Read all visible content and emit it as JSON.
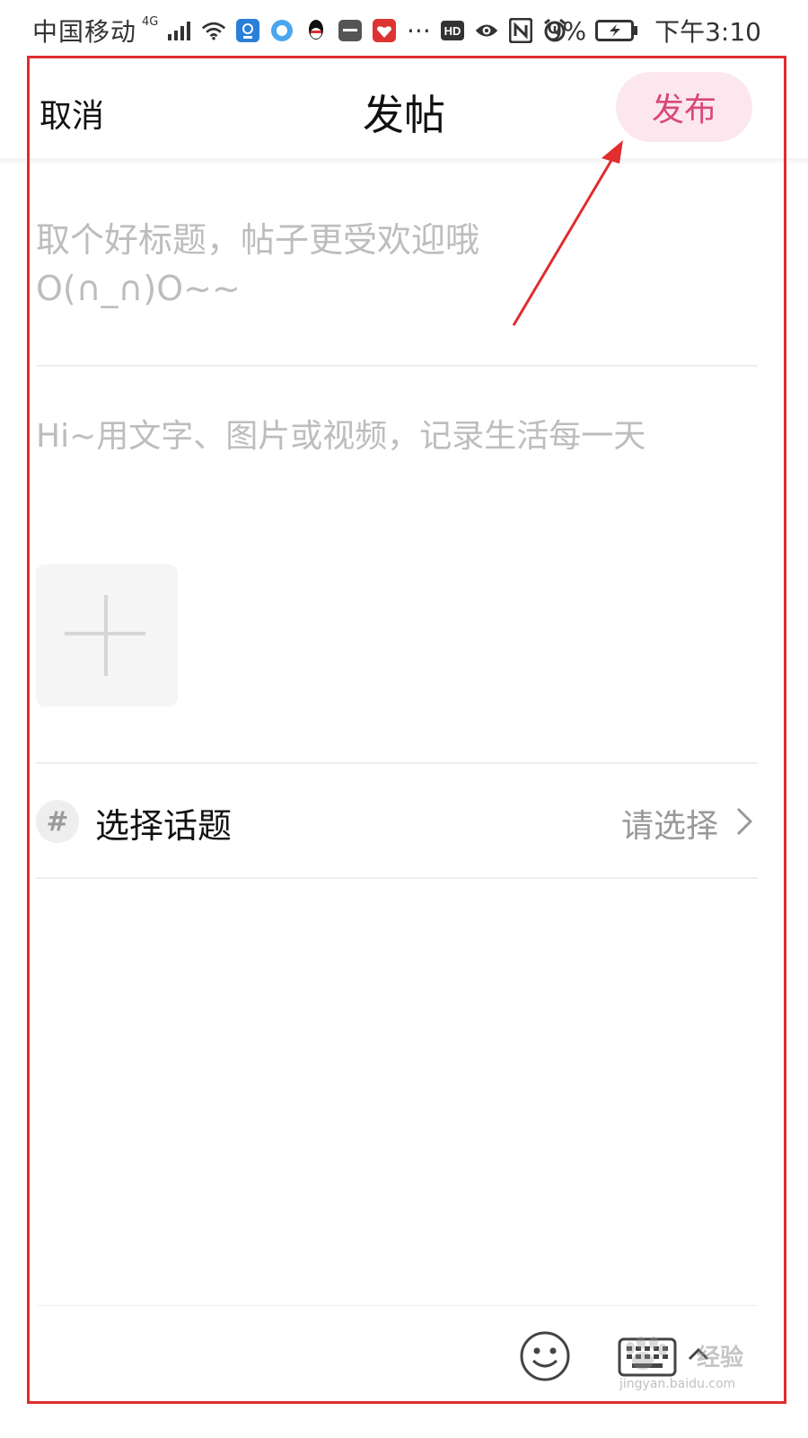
{
  "status_bar": {
    "carrier": "中国移动",
    "network": "4G",
    "battery_percent": "9%",
    "time": "下午3:10",
    "icons": [
      "signal-icon",
      "wifi-icon",
      "app-icon",
      "browser-icon",
      "qq-icon",
      "huawei-icon",
      "gift-icon",
      "more-icon",
      "hd-icon",
      "eye-icon",
      "nfc-icon",
      "alarm-icon",
      "battery-icon"
    ],
    "hd_label": "HD",
    "more_label": "···"
  },
  "nav": {
    "cancel_label": "取消",
    "title": "发帖",
    "publish_label": "发布"
  },
  "editor": {
    "title_placeholder_line1": "取个好标题，帖子更受欢迎哦",
    "title_placeholder_line2": "O(∩_∩)O~~",
    "body_placeholder": "Hi~用文字、图片或视频，记录生活每一天"
  },
  "topic": {
    "icon_label": "#",
    "label": "选择话题",
    "value": "请选择"
  },
  "toolbar": {
    "icons": [
      "emoji-icon",
      "keyboard-icon"
    ]
  },
  "watermark": {
    "main": "经验",
    "url": "jingyan.baidu.com"
  },
  "colors": {
    "accent_pink": "#d8487a",
    "publish_bg": "#fde7ef",
    "annotation_red": "#e02d2d",
    "placeholder_gray": "#bdbdbd"
  }
}
